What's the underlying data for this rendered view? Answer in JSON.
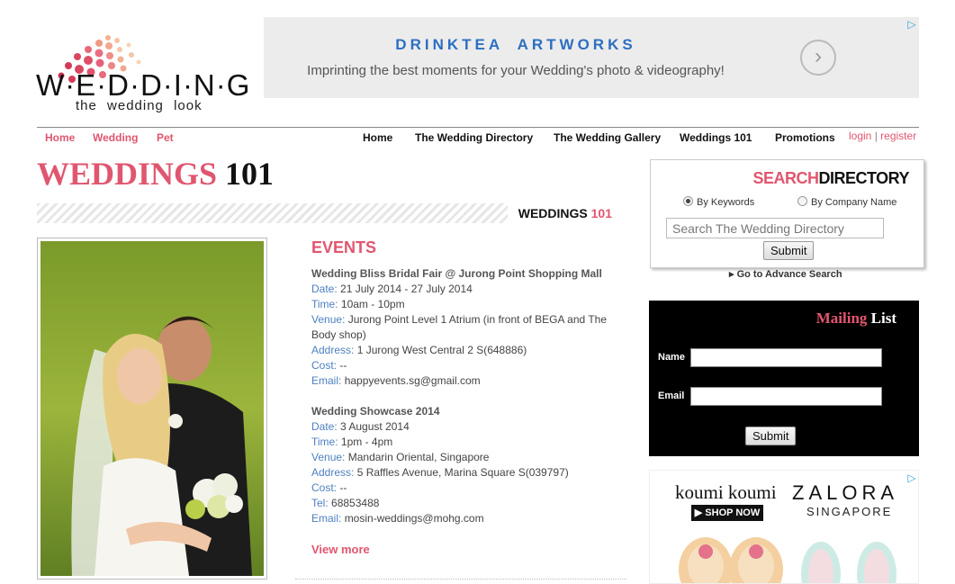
{
  "brand": {
    "logo_word": "W·E·D·D·I·N·G",
    "tagline": "the wedding look"
  },
  "top_ad": {
    "title": "DRINKTEA ARTWORKS",
    "subtitle": "Imprinting the best moments for your Wedding's photo & videography!",
    "arrow_icon": "chevron-right-icon"
  },
  "nav": {
    "left": [
      "Home",
      "Wedding",
      "Pet"
    ],
    "main": [
      "Home",
      "The Wedding Directory",
      "The Wedding Gallery",
      "Weddings 101",
      "Promotions"
    ],
    "login": "login",
    "separator": "|",
    "register": "register"
  },
  "page_title": {
    "part1": "WEDDINGS",
    "part2": "101"
  },
  "band": {
    "part1": "WEDDINGS",
    "part2": "101"
  },
  "events": {
    "heading": "EVENTS",
    "items": [
      {
        "title": "Wedding Bliss Bridal Fair @ Jurong Point Shopping Mall",
        "date_label": "Date:",
        "date": "21 July 2014 - 27 July 2014",
        "time_label": "Time:",
        "time": "10am - 10pm",
        "venue_label": "Venue:",
        "venue": "Jurong Point Level 1 Atrium (in front of BEGA and The Body shop)",
        "address_label": "Address:",
        "address": "1 Jurong West Central 2 S(648886)",
        "cost_label": "Cost:",
        "cost": "--",
        "email_label": "Email:",
        "email": "happyevents.sg@gmail.com"
      },
      {
        "title": "Wedding Showcase 2014",
        "date_label": "Date:",
        "date": "3 August 2014",
        "time_label": "Time:",
        "time": "1pm - 4pm",
        "venue_label": "Venue:",
        "venue": "Mandarin Oriental, Singapore",
        "address_label": "Address:",
        "address": "5 Raffles Avenue, Marina Square S(039797)",
        "cost_label": "Cost:",
        "cost": "--",
        "tel_label": "Tel:",
        "tel": "68853488",
        "email_label": "Email:",
        "email": "mosin-weddings@mohg.com"
      }
    ],
    "view_more": "View more"
  },
  "search": {
    "title1": "SEARCH",
    "title2": "DIRECTORY",
    "radio_keywords": "By Keywords",
    "radio_company": "By Company Name",
    "selected": "keywords",
    "placeholder": "Search The Wedding Directory",
    "submit": "Submit",
    "advanced": "Go to Advance Search"
  },
  "mailing": {
    "title1": "Mailing",
    "title2": "List",
    "name_label": "Name",
    "email_label": "Email",
    "submit": "Submit"
  },
  "bottom_ad": {
    "koumi": "koumi koumi",
    "shop_now": "SHOP NOW",
    "zalora": "ZALORA",
    "zalora_sub": "SINGAPORE"
  },
  "colors": {
    "accent": "#e0566f",
    "label_blue": "#4d7fc0",
    "ad_blue": "#2d6fc1"
  }
}
